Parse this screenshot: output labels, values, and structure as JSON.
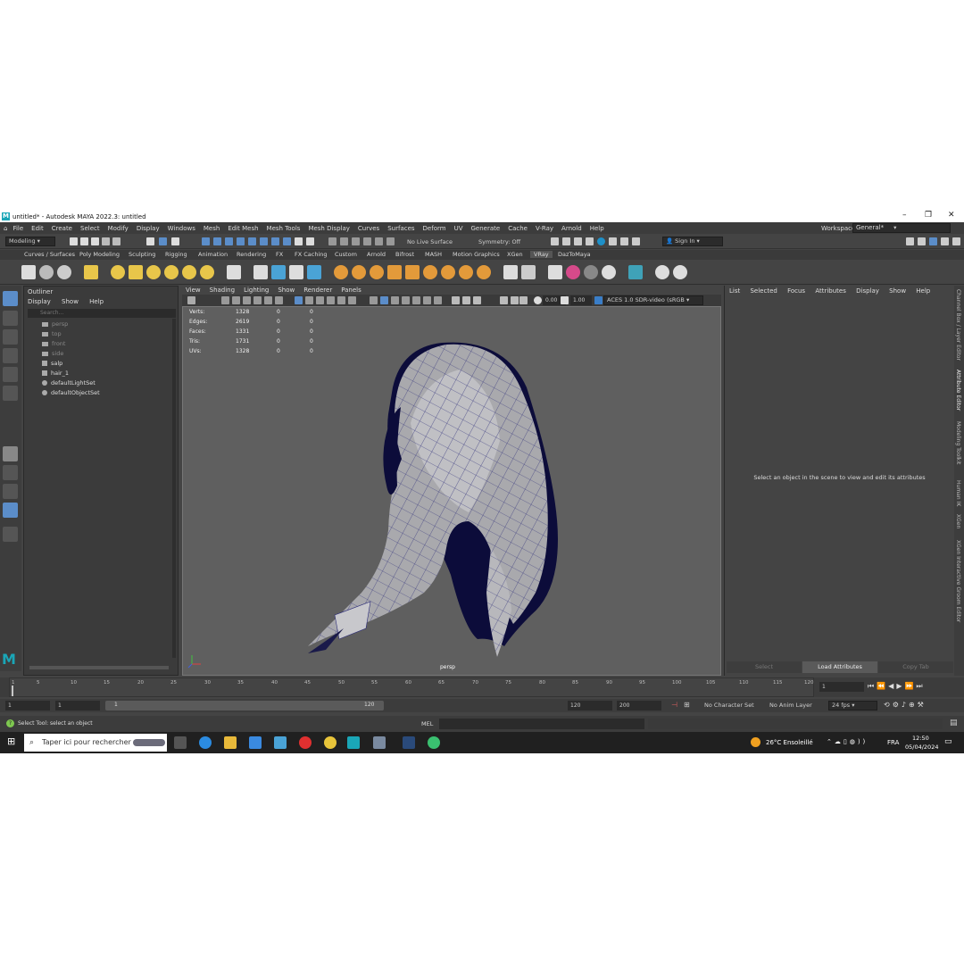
{
  "window": {
    "title": "untitled* - Autodesk MAYA 2022.3: untitled"
  },
  "menubar": [
    "File",
    "Edit",
    "Create",
    "Select",
    "Modify",
    "Display",
    "Windows",
    "Mesh",
    "Edit Mesh",
    "Mesh Tools",
    "Mesh Display",
    "Curves",
    "Surfaces",
    "Deform",
    "UV",
    "Generate",
    "Cache",
    "V-Ray",
    "Arnold",
    "Help"
  ],
  "workspace": {
    "label": "Workspace:",
    "value": "General*"
  },
  "statusline": {
    "mode": "Modeling",
    "live_surface": "No Live Surface",
    "symmetry": "Symmetry: Off",
    "sign_in": "Sign In"
  },
  "shelf_tabs": [
    "Curves / Surfaces",
    "Poly Modeling",
    "Sculpting",
    "Rigging",
    "Animation",
    "Rendering",
    "FX",
    "FX Caching",
    "Custom",
    "Arnold",
    "Bifrost",
    "MASH",
    "Motion Graphics",
    "XGen",
    "VRay",
    "DazToMaya"
  ],
  "outliner": {
    "title": "Outliner",
    "menu": [
      "Display",
      "Show",
      "Help"
    ],
    "search_placeholder": "Search...",
    "items": [
      {
        "label": "persp",
        "dim": true
      },
      {
        "label": "top",
        "dim": true
      },
      {
        "label": "front",
        "dim": true
      },
      {
        "label": "side",
        "dim": true
      },
      {
        "label": "salp",
        "dim": false
      },
      {
        "label": "hair_1",
        "dim": false
      },
      {
        "label": "defaultLightSet",
        "dim": false
      },
      {
        "label": "defaultObjectSet",
        "dim": false
      }
    ]
  },
  "viewport": {
    "menu": [
      "View",
      "Shading",
      "Lighting",
      "Show",
      "Renderer",
      "Panels"
    ],
    "exposure": "0.00",
    "gamma": "1.00",
    "color_space": "ACES 1.0 SDR-video (sRGB",
    "camera": "persp",
    "hud": [
      {
        "label": "Verts:",
        "a": "1328",
        "b": "0",
        "c": "0"
      },
      {
        "label": "Edges:",
        "a": "2619",
        "b": "0",
        "c": "0"
      },
      {
        "label": "Faces:",
        "a": "1331",
        "b": "0",
        "c": "0"
      },
      {
        "label": "Tris:",
        "a": "1731",
        "b": "0",
        "c": "0"
      },
      {
        "label": "UVs:",
        "a": "1328",
        "b": "0",
        "c": "0"
      }
    ]
  },
  "attribute_editor": {
    "menu": [
      "List",
      "Selected",
      "Focus",
      "Attributes",
      "Display",
      "Show",
      "Help"
    ],
    "message": "Select an object in the scene to view and edit its attributes",
    "buttons": {
      "select": "Select",
      "load": "Load Attributes",
      "copy_tab": "Copy Tab"
    }
  },
  "side_tabs": [
    "Channel Box / Layer Editor",
    "Attribute Editor",
    "Modeling Toolkit",
    "Human IK",
    "XGen",
    "XGen Interactive Groom Editor"
  ],
  "timeline": {
    "ticks": [
      "1",
      "5",
      "10",
      "15",
      "20",
      "25",
      "30",
      "35",
      "40",
      "45",
      "50",
      "55",
      "60",
      "65",
      "70",
      "75",
      "80",
      "85",
      "90",
      "95",
      "100",
      "105",
      "110",
      "115",
      "120"
    ],
    "current_frame": "1"
  },
  "range": {
    "start": "1",
    "inner_start": "1",
    "slider_start": "1",
    "slider_end": "120",
    "end": "120",
    "anim_end": "200",
    "character_set": "No Character Set",
    "anim_layer": "No Anim Layer",
    "fps": "24 fps"
  },
  "commandline": {
    "lang": "MEL",
    "help": "Select Tool: select an object"
  },
  "taskbar": {
    "search_placeholder": "Taper ici pour rechercher",
    "weather": "26°C  Ensoleillé",
    "lang": "FRA",
    "time": "12:50",
    "date": "05/04/2024"
  }
}
